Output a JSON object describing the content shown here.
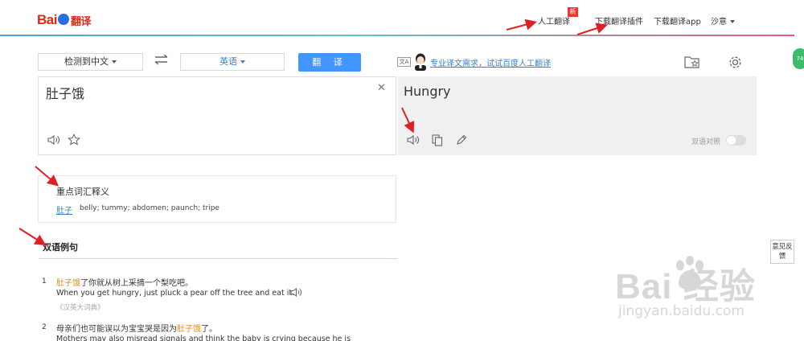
{
  "header": {
    "logo_text": "Bai",
    "logo_suffix": "翻译",
    "nav": {
      "human_translation": "人工翻译",
      "new_badge": "新",
      "download_plugin": "下载翻译插件",
      "download_app": "下载翻译app",
      "user": "沙意"
    }
  },
  "toolbar": {
    "source_lang": "检测到中文",
    "target_lang": "英语",
    "translate_button": "翻 译",
    "promo_icon": "文A",
    "promo_text": "专业译文需求，试试百度人工翻译"
  },
  "input": {
    "text": "肚子饿"
  },
  "output": {
    "text": "Hungry",
    "bilingual_label": "双语对照"
  },
  "dictionary": {
    "title": "重点词汇释义",
    "word": "肚子",
    "definition": "belly; tummy; abdomen; paunch; tripe"
  },
  "examples": {
    "tab_label": "双语例句",
    "items": [
      {
        "num": "1",
        "zh_highlight": "肚子饿",
        "zh_rest": "了你就从树上采摘一个梨吃吧。",
        "en": "When you get hungry, just pluck a pear off the tree and eat it.",
        "source": "《汉英大词典》"
      },
      {
        "num": "2",
        "zh_before": "母亲们也可能误以为宝宝哭是因为",
        "zh_highlight": "肚子饿",
        "zh_after": "了。",
        "en": "Mothers may also misread signals and think the baby is crying because he is"
      }
    ]
  },
  "side": {
    "feedback": "意见反馈",
    "badge": "74"
  },
  "watermark": {
    "main": "Bai  经验",
    "sub": "jingyan.baidu.com"
  },
  "colors": {
    "accent": "#4395ff",
    "highlight": "#e08a1e",
    "link": "#3a7fcf",
    "arrow": "#e02020"
  }
}
